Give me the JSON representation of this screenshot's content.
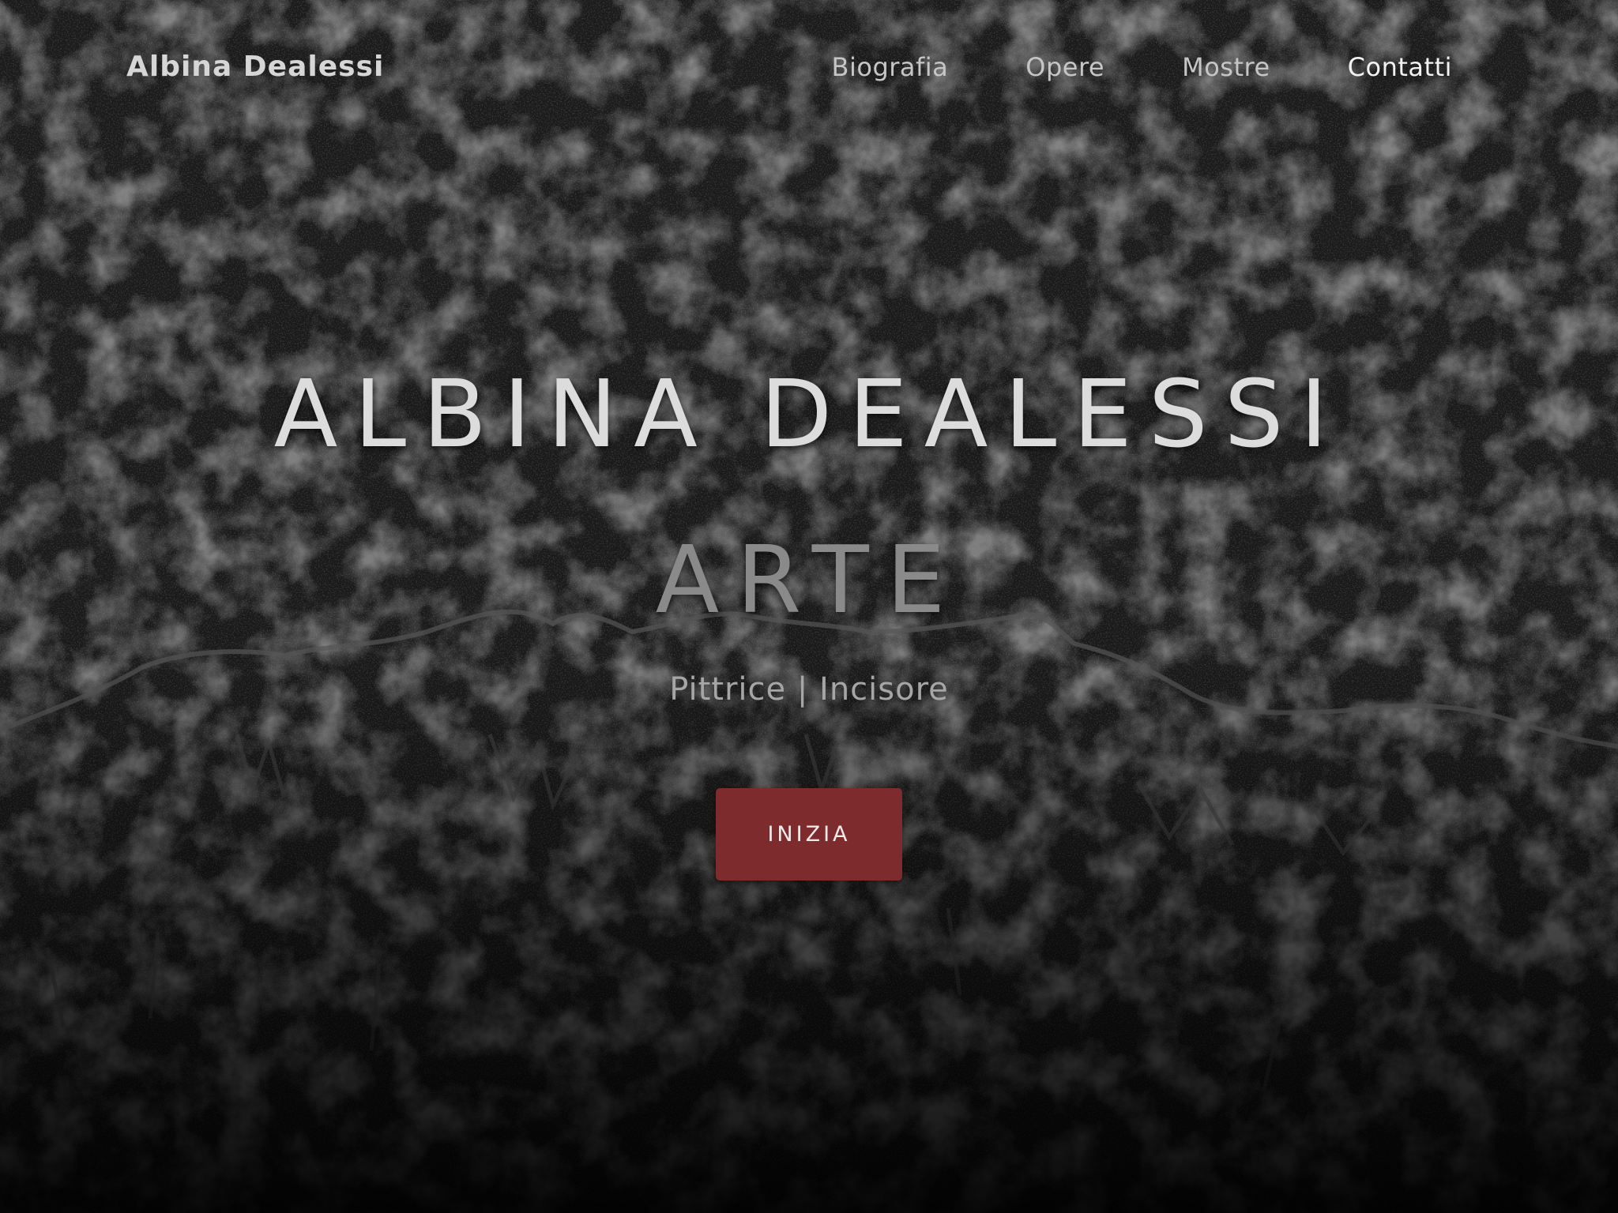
{
  "navbar": {
    "brand": "Albina Dealessi",
    "links": [
      {
        "label": "Biografia"
      },
      {
        "label": "Opere"
      },
      {
        "label": "Mostre"
      },
      {
        "label": "Contatti"
      }
    ]
  },
  "hero": {
    "title": "ALBINA DEALESSI",
    "subtitle": "ARTE",
    "tagline": "Pittrice | Incisore",
    "cta_label": "INIZIA"
  },
  "colors": {
    "cta_background": "#7d2b2d",
    "page_background": "#1b1b1b",
    "title_text": "#dcdcdc"
  }
}
